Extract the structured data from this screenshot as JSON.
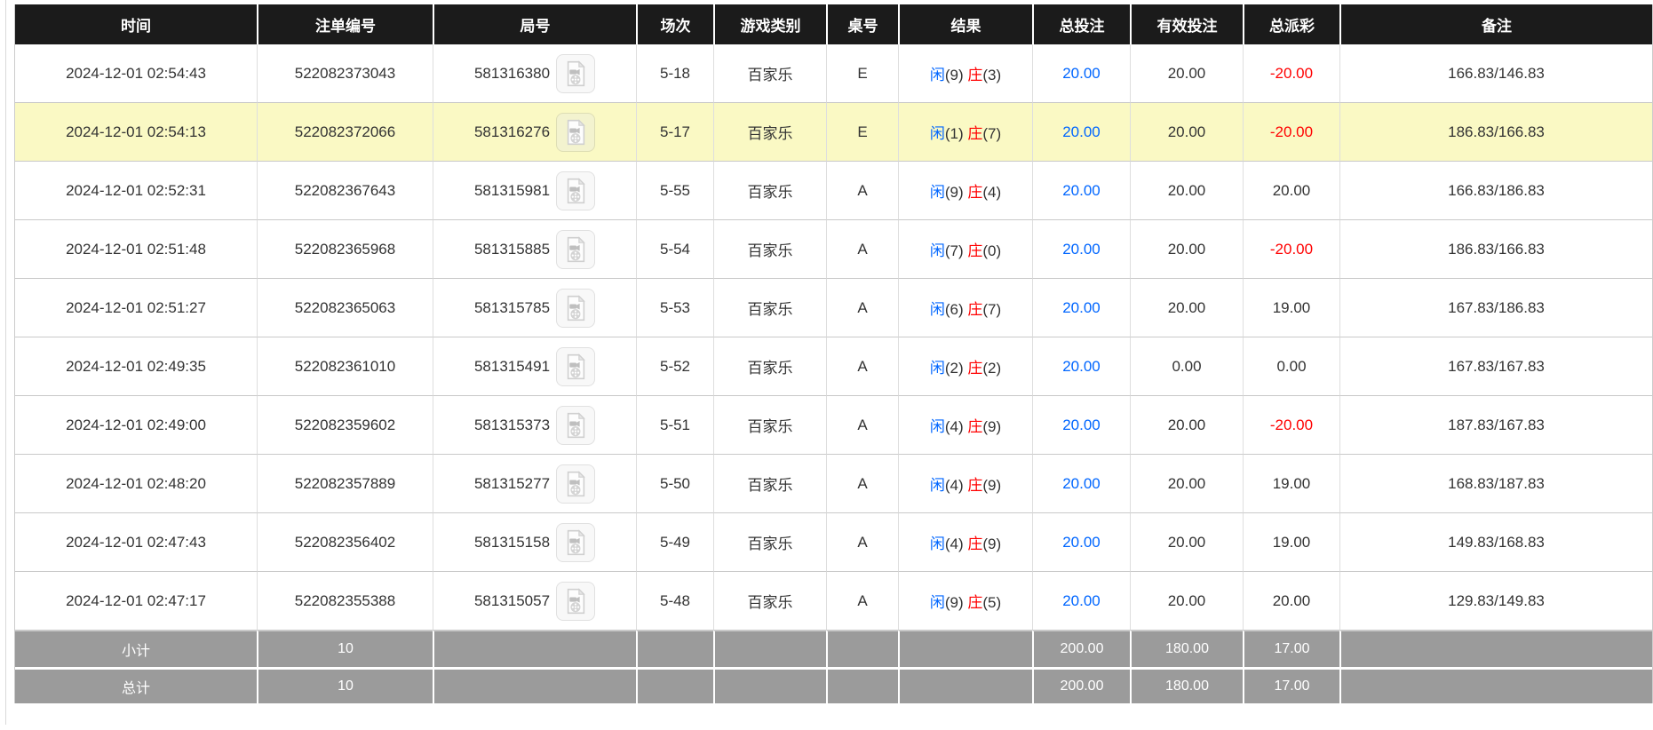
{
  "colors": {
    "accent_blue": "#0066ff",
    "loss_red": "#ff0000",
    "highlight_yellow": "#faf9c4",
    "header_bg": "#1b1b1b",
    "footer_bg": "#9b9b9b"
  },
  "table": {
    "columns": [
      "时间",
      "注单编号",
      "局号",
      "场次",
      "游戏类别",
      "桌号",
      "结果",
      "总投注",
      "有效投注",
      "总派彩",
      "备注"
    ],
    "rows": [
      {
        "time": "2024-12-01 02:54:43",
        "bet_id": "522082373043",
        "round_id": "581316380",
        "session": "5-18",
        "game": "百家乐",
        "table_no": "E",
        "player": "闲",
        "player_score": "(9)",
        "banker": "庄",
        "banker_score": "(3)",
        "total_bet": "20.00",
        "valid_bet": "20.00",
        "payout": "-20.00",
        "remark": "166.83/146.83",
        "highlighted": false
      },
      {
        "time": "2024-12-01 02:54:13",
        "bet_id": "522082372066",
        "round_id": "581316276",
        "session": "5-17",
        "game": "百家乐",
        "table_no": "E",
        "player": "闲",
        "player_score": "(1)",
        "banker": "庄",
        "banker_score": "(7)",
        "total_bet": "20.00",
        "valid_bet": "20.00",
        "payout": "-20.00",
        "remark": "186.83/166.83",
        "highlighted": true
      },
      {
        "time": "2024-12-01 02:52:31",
        "bet_id": "522082367643",
        "round_id": "581315981",
        "session": "5-55",
        "game": "百家乐",
        "table_no": "A",
        "player": "闲",
        "player_score": "(9)",
        "banker": "庄",
        "banker_score": "(4)",
        "total_bet": "20.00",
        "valid_bet": "20.00",
        "payout": "20.00",
        "remark": "166.83/186.83",
        "highlighted": false
      },
      {
        "time": "2024-12-01 02:51:48",
        "bet_id": "522082365968",
        "round_id": "581315885",
        "session": "5-54",
        "game": "百家乐",
        "table_no": "A",
        "player": "闲",
        "player_score": "(7)",
        "banker": "庄",
        "banker_score": "(0)",
        "total_bet": "20.00",
        "valid_bet": "20.00",
        "payout": "-20.00",
        "remark": "186.83/166.83",
        "highlighted": false
      },
      {
        "time": "2024-12-01 02:51:27",
        "bet_id": "522082365063",
        "round_id": "581315785",
        "session": "5-53",
        "game": "百家乐",
        "table_no": "A",
        "player": "闲",
        "player_score": "(6)",
        "banker": "庄",
        "banker_score": "(7)",
        "total_bet": "20.00",
        "valid_bet": "20.00",
        "payout": "19.00",
        "remark": "167.83/186.83",
        "highlighted": false
      },
      {
        "time": "2024-12-01 02:49:35",
        "bet_id": "522082361010",
        "round_id": "581315491",
        "session": "5-52",
        "game": "百家乐",
        "table_no": "A",
        "player": "闲",
        "player_score": "(2)",
        "banker": "庄",
        "banker_score": "(2)",
        "total_bet": "20.00",
        "valid_bet": "0.00",
        "payout": "0.00",
        "remark": "167.83/167.83",
        "highlighted": false
      },
      {
        "time": "2024-12-01 02:49:00",
        "bet_id": "522082359602",
        "round_id": "581315373",
        "session": "5-51",
        "game": "百家乐",
        "table_no": "A",
        "player": "闲",
        "player_score": "(4)",
        "banker": "庄",
        "banker_score": "(9)",
        "total_bet": "20.00",
        "valid_bet": "20.00",
        "payout": "-20.00",
        "remark": "187.83/167.83",
        "highlighted": false
      },
      {
        "time": "2024-12-01 02:48:20",
        "bet_id": "522082357889",
        "round_id": "581315277",
        "session": "5-50",
        "game": "百家乐",
        "table_no": "A",
        "player": "闲",
        "player_score": "(4)",
        "banker": "庄",
        "banker_score": "(9)",
        "total_bet": "20.00",
        "valid_bet": "20.00",
        "payout": "19.00",
        "remark": "168.83/187.83",
        "highlighted": false
      },
      {
        "time": "2024-12-01 02:47:43",
        "bet_id": "522082356402",
        "round_id": "581315158",
        "session": "5-49",
        "game": "百家乐",
        "table_no": "A",
        "player": "闲",
        "player_score": "(4)",
        "banker": "庄",
        "banker_score": "(9)",
        "total_bet": "20.00",
        "valid_bet": "20.00",
        "payout": "19.00",
        "remark": "149.83/168.83",
        "highlighted": false
      },
      {
        "time": "2024-12-01 02:47:17",
        "bet_id": "522082355388",
        "round_id": "581315057",
        "session": "5-48",
        "game": "百家乐",
        "table_no": "A",
        "player": "闲",
        "player_score": "(9)",
        "banker": "庄",
        "banker_score": "(5)",
        "total_bet": "20.00",
        "valid_bet": "20.00",
        "payout": "20.00",
        "remark": "129.83/149.83",
        "highlighted": false
      }
    ],
    "subtotal": {
      "label": "小计",
      "count": "10",
      "total_bet": "200.00",
      "valid_bet": "180.00",
      "payout": "17.00"
    },
    "total": {
      "label": "总计",
      "count": "10",
      "total_bet": "200.00",
      "valid_bet": "180.00",
      "payout": "17.00"
    }
  }
}
